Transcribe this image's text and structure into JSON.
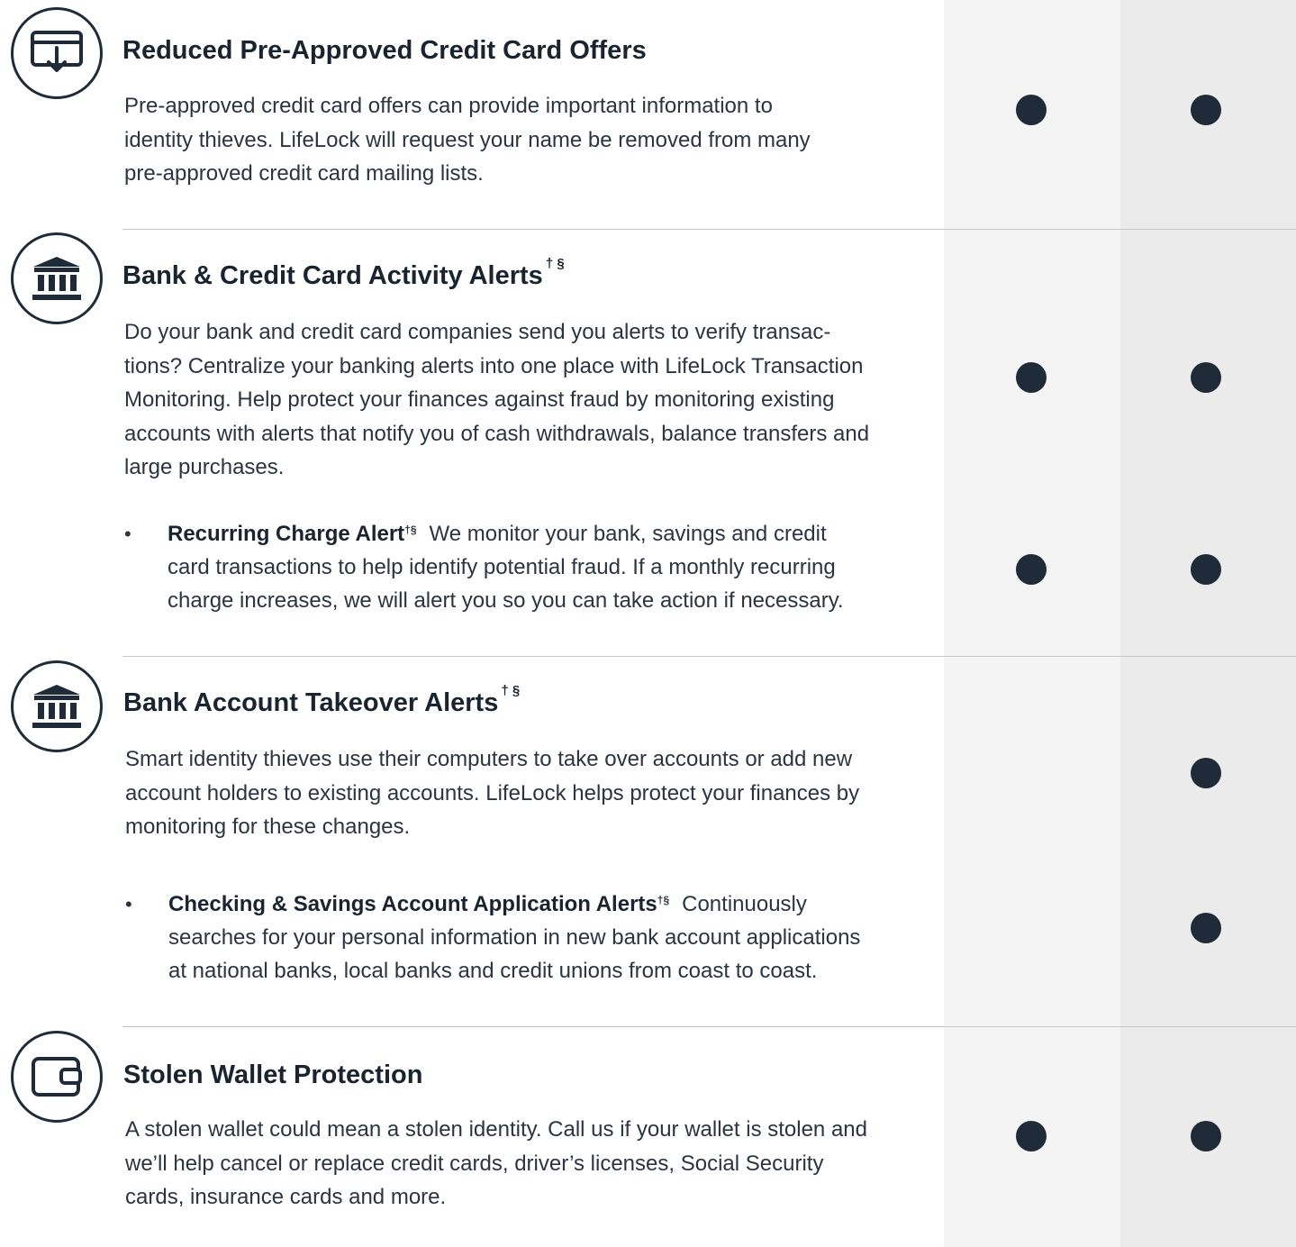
{
  "sections": [
    {
      "title": "Reduced Pre-Approved Credit Card Offers",
      "sup": "",
      "description": "Pre-approved credit card offers can provide important information to identity thieves. LifeLock will request your name be removed from many pre-approved credit card mailing lists.",
      "icon": "credit-card-download-icon",
      "plan_a_included": true,
      "plan_b_included": true
    },
    {
      "title": "Bank & Credit Card Activity Alerts",
      "sup": "† §",
      "description": "Do your bank and credit card companies send you alerts to verify transac- tions? Centralize your banking alerts into one place with LifeLock Transaction Monitoring. Help protect your finances against fraud by monitoring existing accounts with alerts that notify you of cash withdrawals, balance transfers and large purchases.",
      "icon": "bank-icon",
      "plan_a_included": true,
      "plan_b_included": true,
      "bullet": {
        "title": "Recurring Charge Alert",
        "sup": "†§",
        "text": "We monitor your bank, savings and credit card transactions to help identify potential fraud. If a monthly recurring charge increases, we will alert you so you can take action if necessary.",
        "plan_a_included": true,
        "plan_b_included": true
      }
    },
    {
      "title": "Bank Account Takeover Alerts",
      "sup": "† §",
      "description": "Smart identity thieves use their computers to take over accounts or add new account holders to existing accounts. LifeLock helps protect your finances by monitoring for these changes.",
      "icon": "bank-icon",
      "plan_a_included": false,
      "plan_b_included": true,
      "bullet": {
        "title": "Checking & Savings Account Application Alerts",
        "sup": "†§",
        "text": "Continuously searches for your personal information in new bank account applications at national banks, local banks and credit unions from coast to coast.",
        "plan_a_included": false,
        "plan_b_included": true
      }
    },
    {
      "title": "Stolen Wallet Protection",
      "sup": "",
      "description": "A stolen wallet could mean a stolen identity. Call us if your wallet is stolen and we’ll help cancel or replace credit cards, driver’s licenses, Social Security cards, insurance cards and more.",
      "icon": "wallet-icon",
      "plan_a_included": true,
      "plan_b_included": true
    }
  ],
  "colors": {
    "ink": "#1f2b38",
    "column_a_bg": "#f4f4f4",
    "column_b_bg": "#ebebeb",
    "divider": "#c7c7c7"
  }
}
